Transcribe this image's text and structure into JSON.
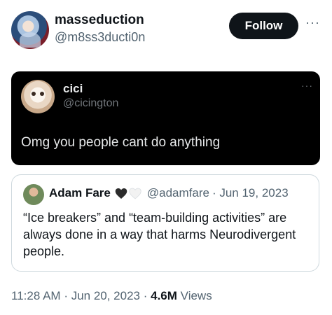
{
  "header": {
    "display_name": "masseduction",
    "handle": "@m8ss3ducti0n",
    "follow_label": "Follow",
    "more_label": "···"
  },
  "embedded_post": {
    "display_name": "cici",
    "handle": "@cicington",
    "text": "Omg you people cant do anything",
    "more_label": "···"
  },
  "quoted_post": {
    "display_name": "Adam Fare",
    "handle": "@adamfare",
    "date": "· Jun 19, 2023",
    "text": "“Ice breakers” and “team-building activities” are always done in a way that harms Neurodivergent people."
  },
  "footer": {
    "time": "11:28 AM",
    "date": "· Jun 20, 2023 ·",
    "views_count": "4.6M",
    "views_label": "Views"
  },
  "colors": {
    "text_primary": "#0f1419",
    "text_secondary": "#536471",
    "follow_bg": "#0f1419",
    "embed_bg": "#000000"
  }
}
